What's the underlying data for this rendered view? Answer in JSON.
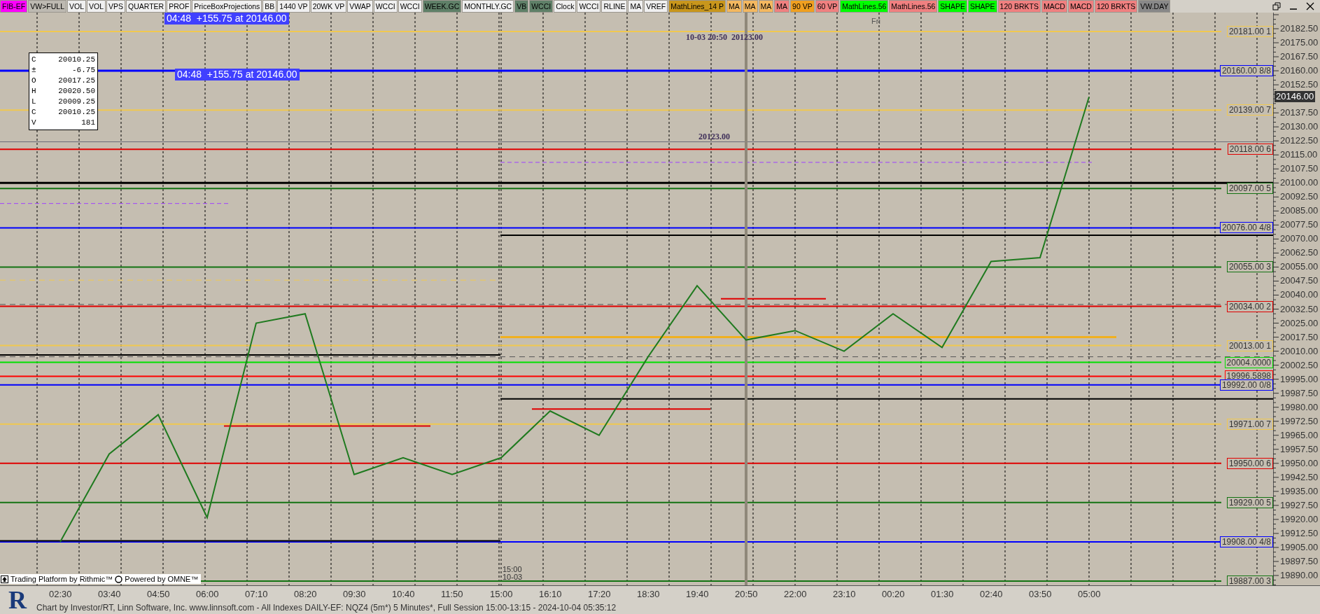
{
  "toolbar": [
    {
      "label": "FIB-EF",
      "color": "#ff00ff"
    },
    {
      "label": "VW>FULL",
      "color": "#bdb9b1"
    },
    {
      "label": "VOL",
      "color": "#f0f0f0"
    },
    {
      "label": "VOL",
      "color": "#f0f0f0"
    },
    {
      "label": "VPS",
      "color": "#f0f0f0"
    },
    {
      "label": "QUARTER",
      "color": "#f0f0f0"
    },
    {
      "label": "PROF",
      "color": "#f0f0f0"
    },
    {
      "label": "PriceBoxProjections",
      "color": "#f0f0f0"
    },
    {
      "label": "BB",
      "color": "#f0f0f0"
    },
    {
      "label": "1440 VP",
      "color": "#f0f0f0"
    },
    {
      "label": "20WK VP",
      "color": "#f0f0f0"
    },
    {
      "label": "VWAP",
      "color": "#f0f0f0"
    },
    {
      "label": "WCCI",
      "color": "#f0f0f0"
    },
    {
      "label": "WCCI",
      "color": "#f0f0f0"
    },
    {
      "label": "WEEK.GC",
      "color": "#5f8068"
    },
    {
      "label": "MONTHLY.GC",
      "color": "#f0f0f0"
    },
    {
      "label": "VB",
      "color": "#5f8068"
    },
    {
      "label": "WCCI",
      "color": "#5f8068"
    },
    {
      "label": "Clock",
      "color": "#f0f0f0"
    },
    {
      "label": "WCCI",
      "color": "#f0f0f0"
    },
    {
      "label": "RLINE",
      "color": "#f0f0f0"
    },
    {
      "label": "MA",
      "color": "#f0f0f0"
    },
    {
      "label": "VREF",
      "color": "#f0f0f0"
    },
    {
      "label": "MathLines_14 P",
      "color": "#c8961c"
    },
    {
      "label": "MA",
      "color": "#f4b860"
    },
    {
      "label": "MA",
      "color": "#f4b860"
    },
    {
      "label": "MA",
      "color": "#f4b860"
    },
    {
      "label": "MA",
      "color": "#f08080"
    },
    {
      "label": "90 VP",
      "color": "#f0a020"
    },
    {
      "label": "60 VP",
      "color": "#f08080"
    },
    {
      "label": "MathLines.56",
      "color": "#00ff00"
    },
    {
      "label": "MathLines.56",
      "color": "#f08080"
    },
    {
      "label": "SHAPE",
      "color": "#00ff00"
    },
    {
      "label": "SHAPE",
      "color": "#00ff00"
    },
    {
      "label": "120 BRKTS",
      "color": "#f08080"
    },
    {
      "label": "MACD",
      "color": "#f08080"
    },
    {
      "label": "MACD",
      "color": "#f08080"
    },
    {
      "label": "120 BRKTS",
      "color": "#f08080"
    },
    {
      "label": "VW.DAY",
      "color": "#888888"
    }
  ],
  "chart": {
    "change_banner_top": "04:48  +155.75 at 20146.00",
    "change_banner": "04:48  +155.75 at 20146.00",
    "bar_stamp": "10-03 20:50  20123.00",
    "level_note": "20123.00",
    "day_label": "Fri",
    "session_time": "15:00",
    "session_date": "10-03",
    "current_price": "20146.00",
    "data_window": [
      {
        "label": "C",
        "value": "20010.25"
      },
      {
        "label": "±",
        "value": "-6.75"
      },
      {
        "label": "O",
        "value": "20017.25"
      },
      {
        "label": "H",
        "value": "20020.50"
      },
      {
        "label": "L",
        "value": "20009.25"
      },
      {
        "label": "C",
        "value": "20010.25"
      },
      {
        "label": "V",
        "value": "181"
      }
    ],
    "chart_data": {
      "type": "line",
      "grid": true,
      "ref_lines": [
        {
          "axis": "y",
          "value": 20181,
          "label": "20181.00 1",
          "color": "#f0c850"
        },
        {
          "axis": "y",
          "value": 20160,
          "label": "20160.00 8/8",
          "color": "#0000ff"
        },
        {
          "axis": "y",
          "value": 20139,
          "label": "20139.00 7",
          "color": "#f0c850"
        },
        {
          "axis": "y",
          "value": 20118,
          "label": "20118.00 6",
          "color": "#e00000"
        },
        {
          "axis": "y",
          "value": 20097,
          "label": "20097.00 5",
          "color": "#137313"
        },
        {
          "axis": "y",
          "value": 20076,
          "label": "20076.00 4/8",
          "color": "#0000ff"
        },
        {
          "axis": "y",
          "value": 20055,
          "label": "20055.00 3",
          "color": "#137313"
        },
        {
          "axis": "y",
          "value": 20034,
          "label": "20034.00 2",
          "color": "#e00000"
        },
        {
          "axis": "y",
          "value": 20013,
          "label": "20013.00 1",
          "color": "#f0c850"
        },
        {
          "axis": "y",
          "value": 20004,
          "label": "20004.0000",
          "color": "#00e000"
        },
        {
          "axis": "y",
          "value": 19996.5898,
          "label": "19996.5898",
          "color": "#ff0000"
        },
        {
          "axis": "y",
          "value": 19992,
          "label": "19992.00 0/8",
          "color": "#0000ff"
        },
        {
          "axis": "y",
          "value": 19971,
          "label": "19971.00 7",
          "color": "#f0c850"
        },
        {
          "axis": "y",
          "value": 19950,
          "label": "19950.00 6",
          "color": "#e00000"
        },
        {
          "axis": "y",
          "value": 19929,
          "label": "19929.00 5",
          "color": "#137313"
        },
        {
          "axis": "y",
          "value": 19908,
          "label": "19908.00 4/8",
          "color": "#0000ff"
        },
        {
          "axis": "y",
          "value": 19887,
          "label": "19887.00 3",
          "color": "#137313"
        },
        {
          "axis": "y",
          "value": 20100,
          "color": "#000000"
        },
        {
          "axis": "y",
          "value": 20072,
          "color": "#000000"
        },
        {
          "axis": "y",
          "value": 19984.5,
          "color": "#000000"
        },
        {
          "axis": "y",
          "value": 20008,
          "color": "#000000"
        },
        {
          "axis": "y",
          "value": 19908.5,
          "color": "#000000"
        },
        {
          "axis": "y",
          "value": 20017.5,
          "color": "#f0b020"
        },
        {
          "axis": "y",
          "value": 20122,
          "color": "#6a6a78"
        },
        {
          "axis": "y",
          "value": 20111,
          "color": "#a040ff"
        },
        {
          "axis": "y",
          "value": 20089,
          "color": "#a040ff"
        },
        {
          "axis": "y",
          "value": 20035,
          "color": "#555555"
        },
        {
          "axis": "y",
          "value": 20007,
          "color": "#555555"
        },
        {
          "axis": "y",
          "value": 19979,
          "color": "#e00000"
        },
        {
          "axis": "y",
          "value": 20038,
          "color": "#e00000"
        },
        {
          "axis": "y",
          "value": 20048,
          "color": "#f0c850"
        },
        {
          "axis": "y",
          "value": 19970,
          "color": "#e00000"
        },
        {
          "axis": "x",
          "value": "20:50",
          "color": "#8f887a"
        }
      ],
      "ylim": [
        19884.75,
        20191.125
      ],
      "x": [
        "02:30",
        "03:40",
        "04:50",
        "06:00",
        "07:10",
        "08:20",
        "09:30",
        "10:40",
        "11:50",
        "15:00",
        "16:10",
        "17:20",
        "18:30",
        "19:40",
        "20:50",
        "22:00",
        "23:10",
        "00:20",
        "01:30",
        "02:40",
        "03:50",
        "05:00"
      ],
      "series": [
        {
          "color": "#1f7a1f",
          "values": [
            19908,
            19955,
            19976,
            19921,
            20025,
            20030,
            19944,
            19953,
            19944,
            19953,
            19978,
            19965,
            20007,
            20045,
            20016,
            20021,
            20010,
            20030,
            20012,
            20058,
            20060,
            20146
          ]
        }
      ],
      "yticks": [
        {
          "value": 20182.5,
          "label": "20182.50"
        },
        {
          "value": 20175,
          "label": "20175.00"
        },
        {
          "value": 20167.5,
          "label": "20167.50"
        },
        {
          "value": 20160,
          "label": "20160.00"
        },
        {
          "value": 20152.5,
          "label": "20152.50"
        },
        {
          "value": 20137.5,
          "label": "20137.50"
        },
        {
          "value": 20130,
          "label": "20130.00"
        },
        {
          "value": 20122.5,
          "label": "20122.50"
        },
        {
          "value": 20115,
          "label": "20115.00"
        },
        {
          "value": 20107.5,
          "label": "20107.50"
        },
        {
          "value": 20100,
          "label": "20100.00"
        },
        {
          "value": 20092.5,
          "label": "20092.50"
        },
        {
          "value": 20085,
          "label": "20085.00"
        },
        {
          "value": 20077.5,
          "label": "20077.50"
        },
        {
          "value": 20070,
          "label": "20070.00"
        },
        {
          "value": 20062.5,
          "label": "20062.50"
        },
        {
          "value": 20055,
          "label": "20055.00"
        },
        {
          "value": 20047.5,
          "label": "20047.50"
        },
        {
          "value": 20040,
          "label": "20040.00"
        },
        {
          "value": 20032.5,
          "label": "20032.50"
        },
        {
          "value": 20025,
          "label": "20025.00"
        },
        {
          "value": 20017.5,
          "label": "20017.50"
        },
        {
          "value": 20010,
          "label": "20010.00"
        },
        {
          "value": 20002.5,
          "label": "20002.50"
        },
        {
          "value": 19995,
          "label": "19995.00"
        },
        {
          "value": 19987.5,
          "label": "19987.50"
        },
        {
          "value": 19980,
          "label": "19980.00"
        },
        {
          "value": 19972.5,
          "label": "19972.50"
        },
        {
          "value": 19965,
          "label": "19965.00"
        },
        {
          "value": 19957.5,
          "label": "19957.50"
        },
        {
          "value": 19950,
          "label": "19950.00"
        },
        {
          "value": 19942.5,
          "label": "19942.50"
        },
        {
          "value": 19935,
          "label": "19935.00"
        },
        {
          "value": 19927.5,
          "label": "19927.50"
        },
        {
          "value": 19920,
          "label": "19920.00"
        },
        {
          "value": 19912.5,
          "label": "19912.50"
        },
        {
          "value": 19905,
          "label": "19905.00"
        },
        {
          "value": 19897.5,
          "label": "19897.50"
        },
        {
          "value": 19890,
          "label": "19890.00"
        }
      ]
    },
    "branding": {
      "rithmic": "Trading Platform by Rithmic™",
      "omne": "Powered by OMNE™"
    }
  },
  "logo": "R",
  "status_bar": "Chart by Investor/RT, Linn Software, Inc. www.linnsoft.com - All Indexes DAILY-EF: NQZ4 (5m*) 5 Minutes*, Full Session 15:00-13:15 - 2024-10-04 05:35:12"
}
